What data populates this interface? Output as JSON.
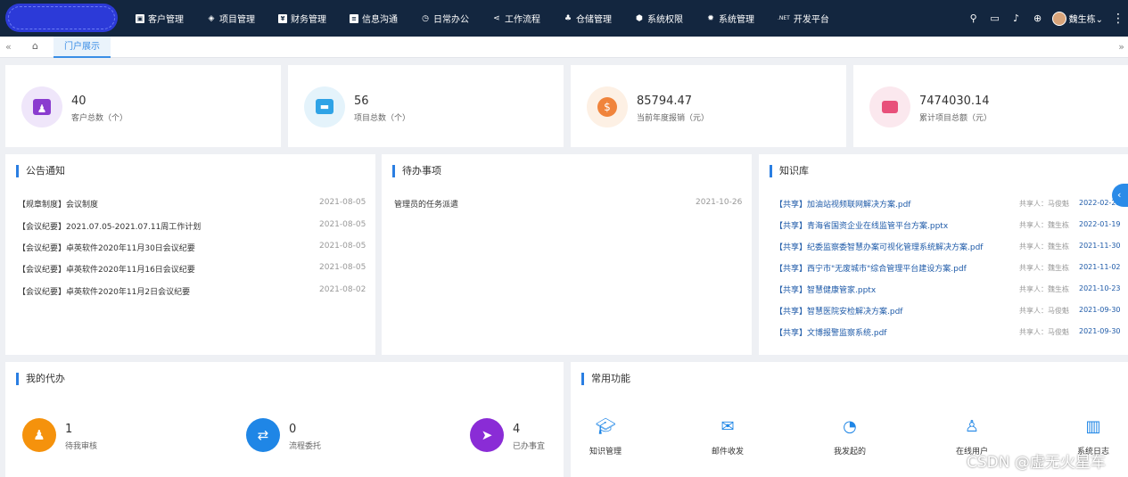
{
  "nav": {
    "items": [
      {
        "label": "客户管理",
        "icon": "customer-icon"
      },
      {
        "label": "项目管理",
        "icon": "layers-icon"
      },
      {
        "label": "财务管理",
        "icon": "finance-icon"
      },
      {
        "label": "信息沟通",
        "icon": "message-icon"
      },
      {
        "label": "日常办公",
        "icon": "clock-icon"
      },
      {
        "label": "工作流程",
        "icon": "share-icon"
      },
      {
        "label": "仓储管理",
        "icon": "boxes-icon"
      },
      {
        "label": "系统权限",
        "icon": "shield-icon"
      },
      {
        "label": "系统管理",
        "icon": "gear-icon"
      },
      {
        "label": "开发平台",
        "icon": "dotnet-icon",
        "badge": ".NET"
      }
    ],
    "user": "魏生栋"
  },
  "tabs": {
    "active": "门户展示"
  },
  "stats": [
    {
      "value": "40",
      "label": "客户总数（个）",
      "color": "#8a3ccf",
      "bg": "#efe6fa"
    },
    {
      "value": "56",
      "label": "项目总数（个）",
      "color": "#2fa3e6",
      "bg": "#e4f3fb"
    },
    {
      "value": "85794.47",
      "label": "当前年度报销（元）",
      "color": "#f0843c",
      "bg": "#fdf0e4"
    },
    {
      "value": "7474030.14",
      "label": "累计项目总额（元）",
      "color": "#e8507a",
      "bg": "#fbe8ee"
    }
  ],
  "notice": {
    "title": "公告通知",
    "items": [
      {
        "text": "【规章制度】会议制度",
        "date": "2021-08-05"
      },
      {
        "text": "【会议纪要】2021.07.05-2021.07.11周工作计划",
        "date": "2021-08-05"
      },
      {
        "text": "【会议纪要】卓英软件2020年11月30日会议纪要",
        "date": "2021-08-05"
      },
      {
        "text": "【会议纪要】卓英软件2020年11月16日会议纪要",
        "date": "2021-08-05"
      },
      {
        "text": "【会议纪要】卓英软件2020年11月2日会议纪要",
        "date": "2021-08-02"
      }
    ]
  },
  "pending": {
    "title": "待办事项",
    "items": [
      {
        "text": "管理员的任务派遣",
        "date": "2021-10-26"
      }
    ]
  },
  "knowledge": {
    "title": "知识库",
    "items": [
      {
        "text": "【共享】加油站视频联网解决方案.pdf",
        "sharer": "共享人：马俊魁",
        "date": "2022-02-23"
      },
      {
        "text": "【共享】青海省国资企业在线监管平台方案.pptx",
        "sharer": "共享人：魏生栋",
        "date": "2022-01-19"
      },
      {
        "text": "【共享】纪委监察委智慧办案可视化管理系统解决方案.pdf",
        "sharer": "共享人：魏生栋",
        "date": "2021-11-30"
      },
      {
        "text": "【共享】西宁市\"无废城市\"综合管理平台建设方案.pdf",
        "sharer": "共享人：魏生栋",
        "date": "2021-11-02"
      },
      {
        "text": "【共享】智慧健康管家.pptx",
        "sharer": "共享人：魏生栋",
        "date": "2021-10-23"
      },
      {
        "text": "【共享】智慧医院安检解决方案.pdf",
        "sharer": "共享人：马俊魁",
        "date": "2021-09-30"
      },
      {
        "text": "【共享】文博报警监察系统.pdf",
        "sharer": "共享人：马俊魁",
        "date": "2021-09-30"
      }
    ]
  },
  "mytodo": {
    "title": "我的代办",
    "items": [
      {
        "value": "1",
        "label": "待我审核",
        "color": "#f5920c"
      },
      {
        "value": "0",
        "label": "流程委托",
        "color": "#1f86e6"
      },
      {
        "value": "4",
        "label": "已办事宜",
        "color": "#8a2cd6"
      }
    ]
  },
  "functions": {
    "title": "常用功能",
    "items": [
      {
        "label": "知识管理",
        "icon": "graduation-cap-icon"
      },
      {
        "label": "邮件收发",
        "icon": "mail-icon"
      },
      {
        "label": "我发起的",
        "icon": "clock-icon"
      },
      {
        "label": "在线用户",
        "icon": "user-chart-icon"
      },
      {
        "label": "系统日志",
        "icon": "log-book-icon"
      }
    ]
  },
  "watermark": "CSDN @虚无火星车"
}
